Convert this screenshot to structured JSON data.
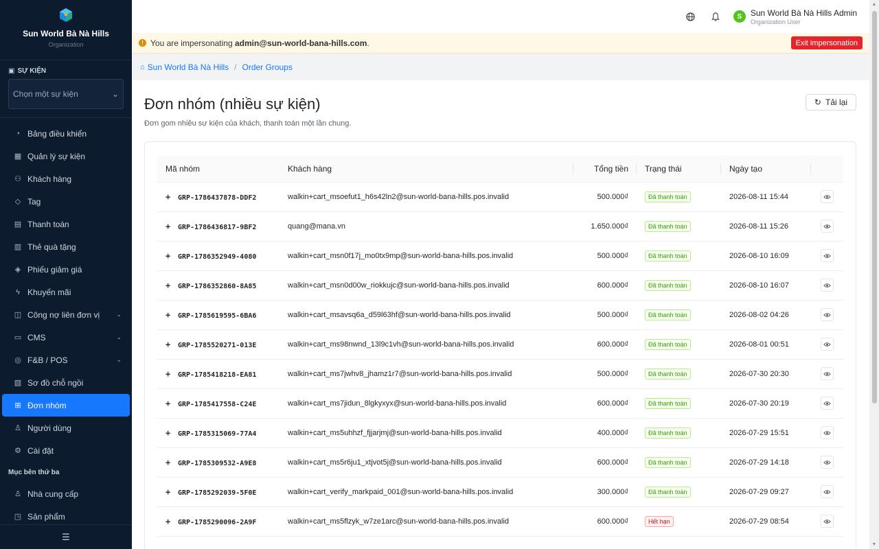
{
  "brand": {
    "name": "Sun World Bà Nà Hills",
    "sub": "Organization"
  },
  "event_section": {
    "title": "SỰ KIỆN",
    "placeholder": "Chọn một sự kiện"
  },
  "nav": {
    "items": [
      {
        "label": "Bảng điều khiển",
        "icon": "dashboard-icon"
      },
      {
        "label": "Quản lý sự kiện",
        "icon": "calendar-icon"
      },
      {
        "label": "Khách hàng",
        "icon": "users-icon"
      },
      {
        "label": "Tag",
        "icon": "tag-icon"
      },
      {
        "label": "Thanh toán",
        "icon": "payment-icon"
      },
      {
        "label": "Thẻ quà tặng",
        "icon": "gift-icon"
      },
      {
        "label": "Phiếu giảm giá",
        "icon": "coupon-icon"
      },
      {
        "label": "Khuyến mãi",
        "icon": "promotion-icon"
      },
      {
        "label": "Công nợ liên đơn vị",
        "icon": "debt-icon"
      },
      {
        "label": "CMS",
        "icon": "cms-icon"
      },
      {
        "label": "F&B / POS",
        "icon": "fnb-icon"
      },
      {
        "label": "Sơ đồ chỗ ngồi",
        "icon": "seatmap-icon"
      },
      {
        "label": "Đơn nhóm",
        "icon": "grid-icon"
      },
      {
        "label": "Người dùng",
        "icon": "user-icon"
      },
      {
        "label": "Cài đặt",
        "icon": "settings-icon"
      }
    ],
    "third_party_title": "Mục bên thứ ba",
    "third_party_items": [
      {
        "label": "Nhà cung cấp",
        "icon": "supplier-icon"
      },
      {
        "label": "Sản phẩm",
        "icon": "product-icon"
      }
    ]
  },
  "header": {
    "user_initial": "S",
    "user_name": "Sun World Bà Nà Hills Admin",
    "user_role": "Organization User"
  },
  "impersonation": {
    "prefix": "You are impersonating ",
    "email": "admin@sun-world-bana-hills.com",
    "suffix": ".",
    "exit_label": "Exit impersonation"
  },
  "breadcrumb": {
    "home": "Sun World Bà Nà Hills",
    "current": "Order Groups"
  },
  "page": {
    "title": "Đơn nhóm (nhiều sự kiện)",
    "subtitle": "Đơn gom nhiều sự kiện của khách, thanh toán một lần chung.",
    "reload_label": "Tải lại"
  },
  "table": {
    "columns": {
      "code": "Mã nhóm",
      "customer": "Khách hàng",
      "total": "Tổng tiền",
      "status": "Trạng thái",
      "created": "Ngày tạo"
    },
    "rows": [
      {
        "code": "GRP-1786437878-DDF2",
        "customer": "walkin+cart_msoefut1_h6s42ln2@sun-world-bana-hills.pos.invalid",
        "total": "500.000₫",
        "status": "Đã thanh toán",
        "status_type": "paid",
        "created": "2026-08-11 15:44"
      },
      {
        "code": "GRP-1786436817-9BF2",
        "customer": "quang@mana.vn",
        "total": "1.650.000₫",
        "status": "Đã thanh toán",
        "status_type": "paid",
        "created": "2026-08-11 15:26"
      },
      {
        "code": "GRP-1786352949-4080",
        "customer": "walkin+cart_msn0f17j_mo0tx9mp@sun-world-bana-hills.pos.invalid",
        "total": "500.000₫",
        "status": "Đã thanh toán",
        "status_type": "paid",
        "created": "2026-08-10 16:09"
      },
      {
        "code": "GRP-1786352860-8A85",
        "customer": "walkin+cart_msn0d00w_riokkujc@sun-world-bana-hills.pos.invalid",
        "total": "600.000₫",
        "status": "Đã thanh toán",
        "status_type": "paid",
        "created": "2026-08-10 16:07"
      },
      {
        "code": "GRP-1785619595-6BA6",
        "customer": "walkin+cart_msavsq6a_d59l63hf@sun-world-bana-hills.pos.invalid",
        "total": "500.000₫",
        "status": "Đã thanh toán",
        "status_type": "paid",
        "created": "2026-08-02 04:26"
      },
      {
        "code": "GRP-1785520271-013E",
        "customer": "walkin+cart_ms98nwnd_13l9c1vh@sun-world-bana-hills.pos.invalid",
        "total": "600.000₫",
        "status": "Đã thanh toán",
        "status_type": "paid",
        "created": "2026-08-01 00:51"
      },
      {
        "code": "GRP-1785418218-EA81",
        "customer": "walkin+cart_ms7jwhv8_jhamz1r7@sun-world-bana-hills.pos.invalid",
        "total": "500.000₫",
        "status": "Đã thanh toán",
        "status_type": "paid",
        "created": "2026-07-30 20:30"
      },
      {
        "code": "GRP-1785417558-C24E",
        "customer": "walkin+cart_ms7jidun_8lgkyxyx@sun-world-bana-hills.pos.invalid",
        "total": "600.000₫",
        "status": "Đã thanh toán",
        "status_type": "paid",
        "created": "2026-07-30 20:19"
      },
      {
        "code": "GRP-1785315069-77A4",
        "customer": "walkin+cart_ms5uhhzf_fjjarjmj@sun-world-bana-hills.pos.invalid",
        "total": "400.000₫",
        "status": "Đã thanh toán",
        "status_type": "paid",
        "created": "2026-07-29 15:51"
      },
      {
        "code": "GRP-1785309532-A9E8",
        "customer": "walkin+cart_ms5r6ju1_xtjvot5j@sun-world-bana-hills.pos.invalid",
        "total": "600.000₫",
        "status": "Đã thanh toán",
        "status_type": "paid",
        "created": "2026-07-29 14:18"
      },
      {
        "code": "GRP-1785292039-5F0E",
        "customer": "walkin+cart_verify_markpaid_001@sun-world-bana-hills.pos.invalid",
        "total": "300.000₫",
        "status": "Đã thanh toán",
        "status_type": "paid",
        "created": "2026-07-29 09:27"
      },
      {
        "code": "GRP-1785290096-2A9F",
        "customer": "walkin+cart_ms5flzyk_w7ze1arc@sun-world-bana-hills.pos.invalid",
        "total": "600.000₫",
        "status": "Hết hạn",
        "status_type": "exp",
        "created": "2026-07-29 08:54"
      }
    ]
  },
  "colors": {
    "sidebar_bg": "#0c1b2e",
    "accent": "#1677ff",
    "paid": "#389e0d",
    "expired": "#cf1322",
    "exit_btn": "#e5242c"
  }
}
